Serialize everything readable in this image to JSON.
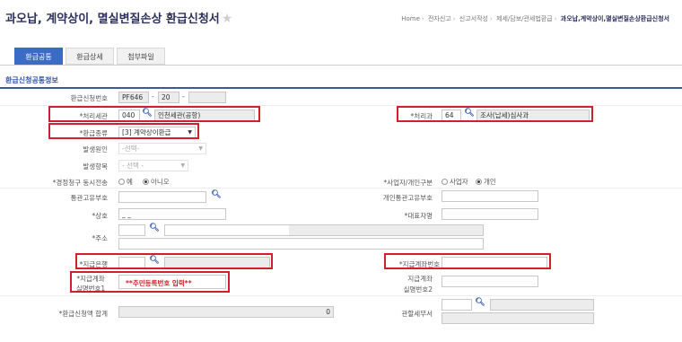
{
  "header": {
    "title": "과오납, 계약상이, 멸실변질손상 환급신청서",
    "breadcrumb": [
      "Home",
      "전자신고",
      "신고서작성",
      "제세/담보/관세법환급",
      "과오납,계약상이,멸실변질손상환급신청서"
    ]
  },
  "tabs": [
    "환급공통",
    "환급상세",
    "첨부파일"
  ],
  "section_title": "환급신청공통정보",
  "fields": {
    "application_no": {
      "label": "환급신청번호",
      "part1": "PF646",
      "part2": "20",
      "part3": ""
    },
    "customs": {
      "label": "*처리세관",
      "code": "040",
      "name": "인천세관(공항)"
    },
    "dept": {
      "label": "*처리과",
      "code": "64",
      "name": "조사(납세)심사과"
    },
    "refund_type": {
      "label": "*환급종류",
      "value": "[3] 계약상이환급"
    },
    "cause": {
      "label": "발생원인",
      "value": "-선택-"
    },
    "item": {
      "label": "발생항목",
      "value": "- 선택 -"
    },
    "correction": {
      "label": "*경정청구 동시전송",
      "yes": "예",
      "no": "아니오"
    },
    "biz_type": {
      "label": "*사업자/개인구분",
      "biz": "사업자",
      "personal": "개인"
    },
    "customs_id": {
      "label": "통관고유부호"
    },
    "personal_id": {
      "label": "개인통관고유부호"
    },
    "company": {
      "label": "*상호",
      "value": "_ _"
    },
    "ceo": {
      "label": "*대표자명"
    },
    "address": {
      "label": "*주소"
    },
    "bank": {
      "label": "*지급은행"
    },
    "account": {
      "label": "*지급계좌번호"
    },
    "owner_id": {
      "label1": "*지급계좌",
      "label2": "실명번호1",
      "value": "**주민등록번호 입력**"
    },
    "owner_id2": {
      "label1": "지급계좌",
      "label2": "실명번호2"
    },
    "total": {
      "label": "*환급신청액 합계",
      "value": "0"
    },
    "tax_office": {
      "label": "관할세무서"
    }
  }
}
